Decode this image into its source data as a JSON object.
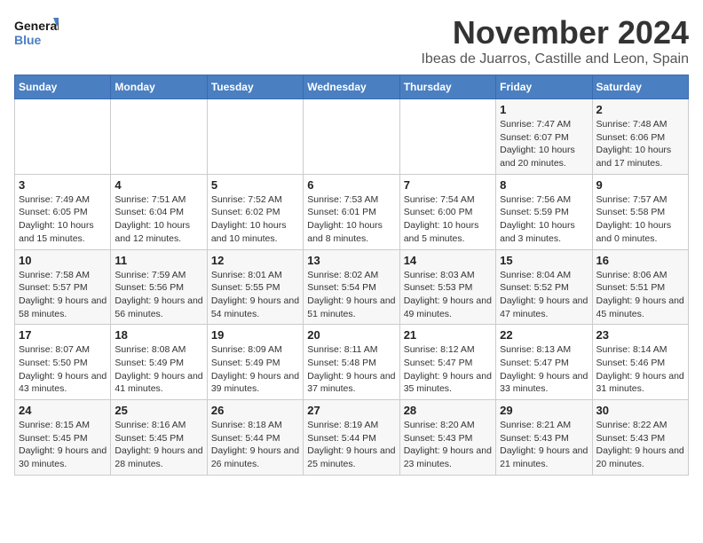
{
  "logo": {
    "line1": "General",
    "line2": "Blue"
  },
  "title": "November 2024",
  "subtitle": "Ibeas de Juarros, Castille and Leon, Spain",
  "weekdays": [
    "Sunday",
    "Monday",
    "Tuesday",
    "Wednesday",
    "Thursday",
    "Friday",
    "Saturday"
  ],
  "weeks": [
    [
      {
        "day": "",
        "info": ""
      },
      {
        "day": "",
        "info": ""
      },
      {
        "day": "",
        "info": ""
      },
      {
        "day": "",
        "info": ""
      },
      {
        "day": "",
        "info": ""
      },
      {
        "day": "1",
        "info": "Sunrise: 7:47 AM\nSunset: 6:07 PM\nDaylight: 10 hours and 20 minutes."
      },
      {
        "day": "2",
        "info": "Sunrise: 7:48 AM\nSunset: 6:06 PM\nDaylight: 10 hours and 17 minutes."
      }
    ],
    [
      {
        "day": "3",
        "info": "Sunrise: 7:49 AM\nSunset: 6:05 PM\nDaylight: 10 hours and 15 minutes."
      },
      {
        "day": "4",
        "info": "Sunrise: 7:51 AM\nSunset: 6:04 PM\nDaylight: 10 hours and 12 minutes."
      },
      {
        "day": "5",
        "info": "Sunrise: 7:52 AM\nSunset: 6:02 PM\nDaylight: 10 hours and 10 minutes."
      },
      {
        "day": "6",
        "info": "Sunrise: 7:53 AM\nSunset: 6:01 PM\nDaylight: 10 hours and 8 minutes."
      },
      {
        "day": "7",
        "info": "Sunrise: 7:54 AM\nSunset: 6:00 PM\nDaylight: 10 hours and 5 minutes."
      },
      {
        "day": "8",
        "info": "Sunrise: 7:56 AM\nSunset: 5:59 PM\nDaylight: 10 hours and 3 minutes."
      },
      {
        "day": "9",
        "info": "Sunrise: 7:57 AM\nSunset: 5:58 PM\nDaylight: 10 hours and 0 minutes."
      }
    ],
    [
      {
        "day": "10",
        "info": "Sunrise: 7:58 AM\nSunset: 5:57 PM\nDaylight: 9 hours and 58 minutes."
      },
      {
        "day": "11",
        "info": "Sunrise: 7:59 AM\nSunset: 5:56 PM\nDaylight: 9 hours and 56 minutes."
      },
      {
        "day": "12",
        "info": "Sunrise: 8:01 AM\nSunset: 5:55 PM\nDaylight: 9 hours and 54 minutes."
      },
      {
        "day": "13",
        "info": "Sunrise: 8:02 AM\nSunset: 5:54 PM\nDaylight: 9 hours and 51 minutes."
      },
      {
        "day": "14",
        "info": "Sunrise: 8:03 AM\nSunset: 5:53 PM\nDaylight: 9 hours and 49 minutes."
      },
      {
        "day": "15",
        "info": "Sunrise: 8:04 AM\nSunset: 5:52 PM\nDaylight: 9 hours and 47 minutes."
      },
      {
        "day": "16",
        "info": "Sunrise: 8:06 AM\nSunset: 5:51 PM\nDaylight: 9 hours and 45 minutes."
      }
    ],
    [
      {
        "day": "17",
        "info": "Sunrise: 8:07 AM\nSunset: 5:50 PM\nDaylight: 9 hours and 43 minutes."
      },
      {
        "day": "18",
        "info": "Sunrise: 8:08 AM\nSunset: 5:49 PM\nDaylight: 9 hours and 41 minutes."
      },
      {
        "day": "19",
        "info": "Sunrise: 8:09 AM\nSunset: 5:49 PM\nDaylight: 9 hours and 39 minutes."
      },
      {
        "day": "20",
        "info": "Sunrise: 8:11 AM\nSunset: 5:48 PM\nDaylight: 9 hours and 37 minutes."
      },
      {
        "day": "21",
        "info": "Sunrise: 8:12 AM\nSunset: 5:47 PM\nDaylight: 9 hours and 35 minutes."
      },
      {
        "day": "22",
        "info": "Sunrise: 8:13 AM\nSunset: 5:47 PM\nDaylight: 9 hours and 33 minutes."
      },
      {
        "day": "23",
        "info": "Sunrise: 8:14 AM\nSunset: 5:46 PM\nDaylight: 9 hours and 31 minutes."
      }
    ],
    [
      {
        "day": "24",
        "info": "Sunrise: 8:15 AM\nSunset: 5:45 PM\nDaylight: 9 hours and 30 minutes."
      },
      {
        "day": "25",
        "info": "Sunrise: 8:16 AM\nSunset: 5:45 PM\nDaylight: 9 hours and 28 minutes."
      },
      {
        "day": "26",
        "info": "Sunrise: 8:18 AM\nSunset: 5:44 PM\nDaylight: 9 hours and 26 minutes."
      },
      {
        "day": "27",
        "info": "Sunrise: 8:19 AM\nSunset: 5:44 PM\nDaylight: 9 hours and 25 minutes."
      },
      {
        "day": "28",
        "info": "Sunrise: 8:20 AM\nSunset: 5:43 PM\nDaylight: 9 hours and 23 minutes."
      },
      {
        "day": "29",
        "info": "Sunrise: 8:21 AM\nSunset: 5:43 PM\nDaylight: 9 hours and 21 minutes."
      },
      {
        "day": "30",
        "info": "Sunrise: 8:22 AM\nSunset: 5:43 PM\nDaylight: 9 hours and 20 minutes."
      }
    ]
  ]
}
